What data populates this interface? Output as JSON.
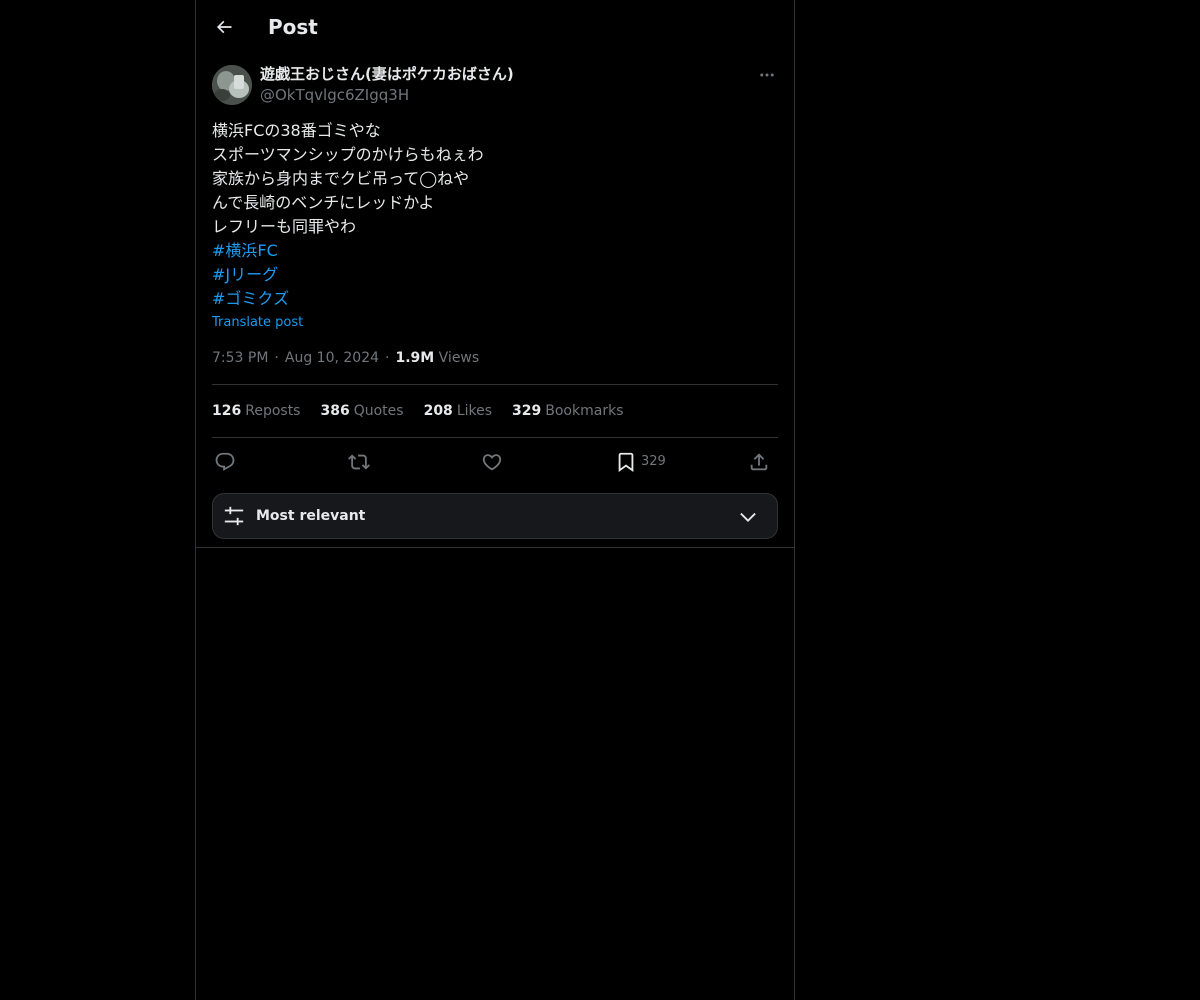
{
  "header": {
    "title": "Post"
  },
  "post": {
    "author": {
      "display_name": "遊戯王おじさん(妻はポケカおばさん)",
      "handle": "@OkTqvlgc6ZIgq3H"
    },
    "lines": [
      "横浜FCの38番ゴミやな",
      "スポーツマンシップのかけらもねぇわ",
      "家族から身内までクビ吊って◯ねや",
      "んで長崎のベンチにレッドかよ",
      "レフリーも同罪やわ"
    ],
    "hashtags": [
      "#横浜FC",
      "#Jリーグ",
      "#ゴミクズ"
    ],
    "translate_label": "Translate post",
    "time": "7:53 PM",
    "date": "Aug 10, 2024",
    "views_count": "1.9M",
    "views_label": "Views",
    "separator": "·"
  },
  "stats": [
    {
      "num": "126",
      "label": "Reposts"
    },
    {
      "num": "386",
      "label": "Quotes"
    },
    {
      "num": "208",
      "label": "Likes"
    },
    {
      "num": "329",
      "label": "Bookmarks"
    }
  ],
  "actions": {
    "reply_icon": "reply-icon",
    "repost_icon": "repost-icon",
    "like_icon": "heart-icon",
    "bookmark_icon": "bookmark-icon",
    "bookmark_count": "329",
    "share_icon": "share-icon"
  },
  "sort": {
    "label": "Most relevant",
    "icon": "sliders-icon"
  },
  "colors": {
    "background": "#000000",
    "text": "#e7e9ea",
    "muted": "#71767b",
    "accent": "#1d9bf0",
    "border": "#2f3336"
  }
}
